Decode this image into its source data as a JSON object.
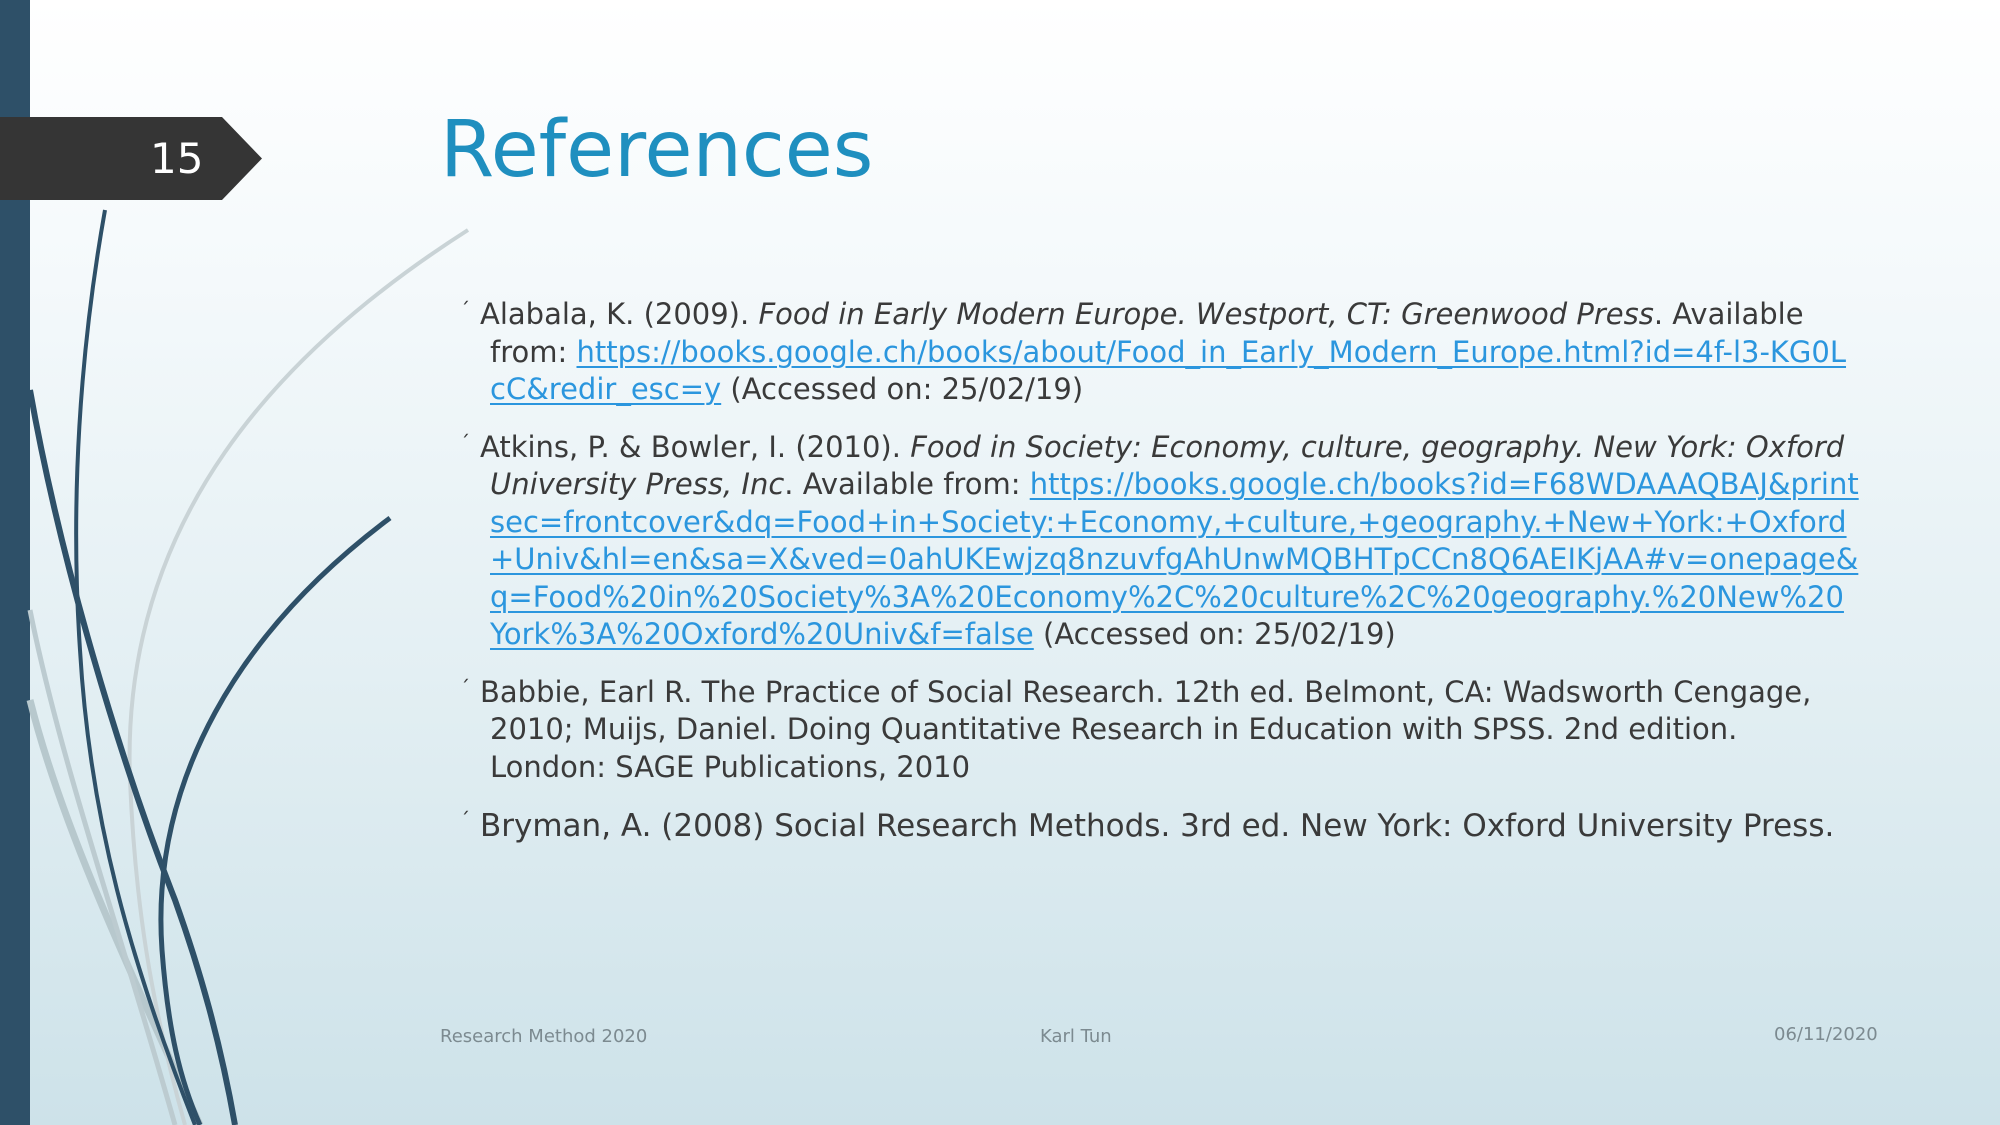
{
  "slide": {
    "number": "15",
    "title": "References"
  },
  "references": [
    {
      "plain_1": "Alabala, K. (2009). ",
      "italic_1": "Food in Early Modern Europe. Westport, CT: Greenwood Press",
      "plain_2": ". Available from: ",
      "link": "https://books.google.ch/books/about/Food_in_Early_Modern_Europe.html?id=4f-l3-KG0LcC&redir_esc=y",
      "accessed": " (Accessed on: 25/02/19)"
    },
    {
      "plain_1": "Atkins, P. & Bowler, I. (2010). ",
      "italic_1": "Food in Society: Economy, culture, geography. New York: Oxford University Press, Inc",
      "plain_2": ". Available from: ",
      "link": "https://books.google.ch/books?id=F68WDAAAQBAJ&printsec=frontcover&dq=Food+in+Society:+Economy,+culture,+geography.+New+York:+Oxford+Univ&hl=en&sa=X&ved=0ahUKEwjzq8nzuvfgAhUnwMQBHTpCCn8Q6AEIKjAA#v=onepage&q=Food%20in%20Society%3A%20Economy%2C%20culture%2C%20geography.%20New%20York%3A%20Oxford%20Univ&f=false",
      "accessed": " (Accessed on: 25/02/19)"
    },
    {
      "text": "Babbie, Earl R. The Practice of Social Research. 12th ed. Belmont, CA: Wadsworth Cengage, 2010; Muijs, Daniel. Doing Quantitative Research in Education with SPSS. 2nd edition. London: SAGE Publications, 2010"
    },
    {
      "text": "Bryman, A. (2008) Social Research Methods. 3rd ed. New York: Oxford University Press."
    }
  ],
  "bullet_glyph": "´",
  "footer": {
    "left": "Research Method 2020",
    "center": "Karl Tun",
    "right": "06/11/2020"
  },
  "colors": {
    "title": "#1f8fbf",
    "link": "#2b96de",
    "body_text": "#3a3a3a",
    "slide_number_tab": "#353535",
    "left_bar": "#2e5068"
  }
}
